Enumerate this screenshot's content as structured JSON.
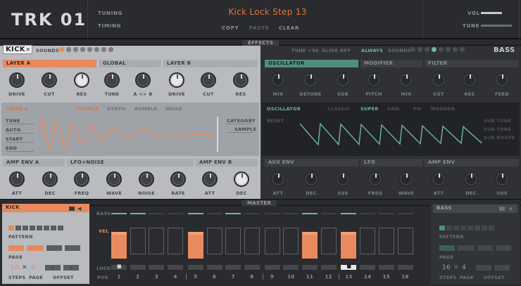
{
  "header": {
    "logo": "TRK 01",
    "tuning": "TUNING",
    "timing": "TIMING",
    "title": "Kick Lock Step 13",
    "copy": "COPY",
    "paste": "PASTE",
    "clear": "CLEAR",
    "vol": "VOL",
    "tune": "TUNE"
  },
  "effects_label": "EFFECTS",
  "master_label": "MASTER",
  "left": {
    "sound": "KICK",
    "sounds_label": "SOUNDS",
    "layer_a": "LAYER A",
    "global": "GLOBAL",
    "layer_b": "LAYER B",
    "knobs_row1": [
      "DRIVE",
      "CUT",
      "RES",
      "TUNE",
      "A <> B",
      "DRIVE",
      "CUT",
      "RES"
    ],
    "layer_panel": "LAYER A",
    "modes": [
      "SAMPLE",
      "SYNTH",
      "RUMBLE",
      "NOISE"
    ],
    "params_left": [
      "TUNE",
      "AUTO",
      "START",
      "END"
    ],
    "params_right": [
      "CATEGORY",
      "SAMPLE"
    ],
    "amp_env_a": "AMP ENV A",
    "lfo_noise": "LFO+NOISE",
    "amp_env_b": "AMP ENV B",
    "knobs_row2": [
      "ATT",
      "DEC",
      "FREQ",
      "WAVE",
      "NOISE",
      "RATE",
      "ATT",
      "DEC"
    ]
  },
  "right": {
    "tune_label": "TUNE +56",
    "glide": "GLIDE OFF",
    "always": "ALWAYS",
    "sounds_label": "SOUNDS",
    "sound": "BASS",
    "osc": "OSCILLATOR",
    "modifier": "MODIFIER",
    "filter": "FILTER",
    "knobs_row1": [
      "MIX",
      "DETUNE",
      "SUB",
      "PITCH",
      "MIX",
      "CUT",
      "RES",
      "FEED"
    ],
    "osc_panel": "OSCILLATOR",
    "modes": [
      "CLASSIC",
      "SUPER",
      "SAW",
      "FM",
      "MODERN"
    ],
    "reset": "RESET",
    "sub": [
      "SUB TUNE",
      "SUB TONE",
      "SUB ROUTE"
    ],
    "aux_env": "AUX ENV",
    "lfo": "LFO",
    "amp_env": "AMP ENV",
    "knobs_row2": [
      "ATT",
      "DEC",
      "SUS",
      "FREQ",
      "WAVE",
      "ATT",
      "DEC",
      "SUS"
    ]
  },
  "seq": {
    "track": "KICK",
    "bass_track": "BASS",
    "bass_label": "BASS",
    "vel_label": "VEL",
    "lock_label": "LOCK",
    "pos_label": "POS",
    "pattern": "PATTERN",
    "page": "PAGE",
    "steps_val": "16",
    "page_val": "4",
    "steps": "STEPS",
    "page2": "PAGE",
    "offset": "OFFSET",
    "positions": [
      "1",
      "2",
      "3",
      "4",
      "5",
      "6",
      "7",
      "8",
      "9",
      "10",
      "11",
      "12",
      "13",
      "14",
      "15",
      "16"
    ],
    "velocity": [
      0.85,
      0,
      0,
      0,
      0.85,
      0,
      0,
      0,
      0,
      0,
      0.85,
      0,
      0.85,
      0,
      0,
      0
    ],
    "locked": [
      1,
      0,
      0,
      0,
      0,
      0,
      0,
      0,
      0,
      0,
      0,
      0,
      1,
      0,
      0,
      0
    ],
    "bass_row": [
      1,
      1,
      0,
      0,
      1,
      0,
      1,
      0,
      0,
      0,
      1,
      0,
      1,
      0,
      0,
      0
    ]
  },
  "colors": {
    "accent": "#e98a5e",
    "teal": "#6fb6a1"
  }
}
